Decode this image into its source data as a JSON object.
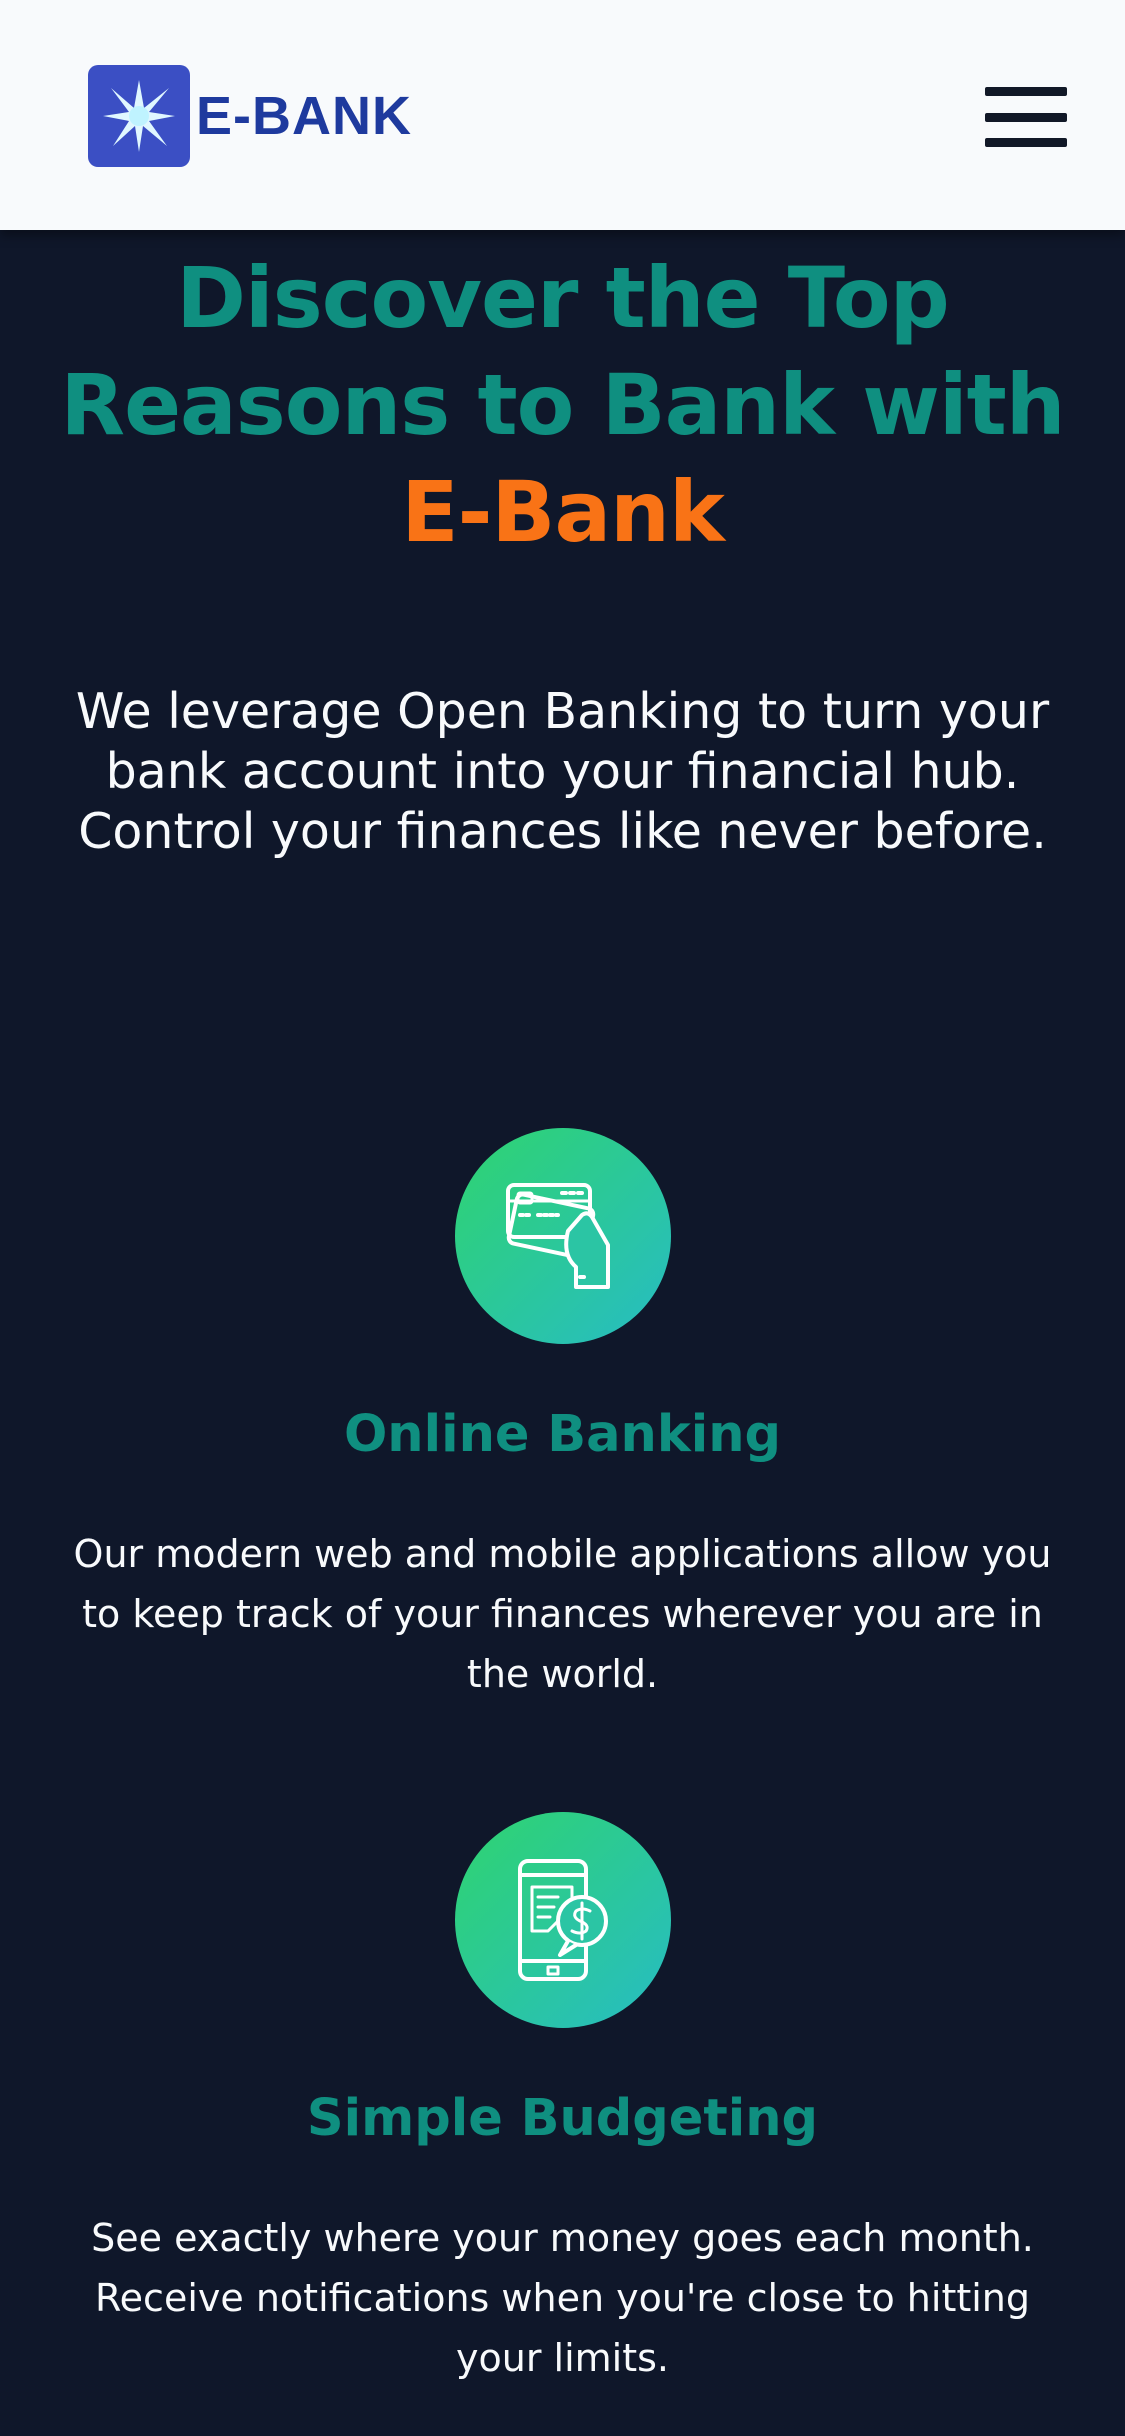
{
  "header": {
    "logo_text": "E-BANK",
    "logo_icon": "starburst-logo-icon",
    "menu_icon": "hamburger-menu-icon"
  },
  "hero": {
    "title_line1": "Discover the Top",
    "title_line2": "Reasons to Bank with",
    "title_brand": "E-Bank",
    "text_line1": "We leverage Open Banking to turn your",
    "text_line2": "bank account into your financial hub.",
    "text_line3": "Control your finances like never before."
  },
  "features": [
    {
      "icon": "card-in-hand-icon",
      "title": "Online Banking",
      "text_line1": "Our modern web and mobile applications allow you",
      "text_line2": "to keep track of your finances wherever you are in",
      "text_line3": "the world."
    },
    {
      "icon": "phone-dollar-icon",
      "title": "Simple Budgeting",
      "text_line1": "See exactly where your money goes each month.",
      "text_line2": "Receive notifications when you're close to hitting",
      "text_line3": "your limits."
    }
  ],
  "colors": {
    "background": "#0f172a",
    "header": "#f8fafc",
    "accent_teal": "#0f8f80",
    "brand_orange": "#f97316",
    "logo_blue": "#1e3a9e"
  }
}
